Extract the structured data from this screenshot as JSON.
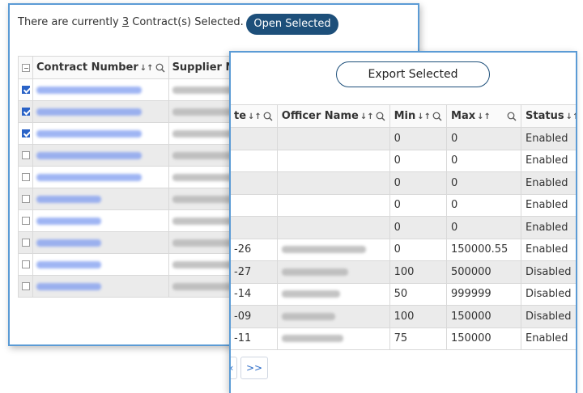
{
  "back_panel": {
    "status_prefix": "There are currently ",
    "selected_count": "3",
    "status_suffix": " Contract(s) Selected.",
    "open_button": "Open Selected",
    "columns": {
      "contract_number": "Contract Number",
      "supplier": "Supplier N"
    },
    "rows": [
      {
        "checked": true
      },
      {
        "checked": true
      },
      {
        "checked": true
      },
      {
        "checked": false
      },
      {
        "checked": false
      },
      {
        "checked": false
      },
      {
        "checked": false
      },
      {
        "checked": false
      },
      {
        "checked": false
      },
      {
        "checked": false
      }
    ]
  },
  "front_panel": {
    "export_button": "Export Selected",
    "columns": {
      "date": "te",
      "officer": "Officer Name",
      "min": "Min",
      "max": "Max",
      "status": "Status"
    },
    "rows": [
      {
        "date": "",
        "min": "0",
        "max": "0",
        "status": "Enabled"
      },
      {
        "date": "",
        "min": "0",
        "max": "0",
        "status": "Enabled"
      },
      {
        "date": "",
        "min": "0",
        "max": "0",
        "status": "Enabled"
      },
      {
        "date": "",
        "min": "0",
        "max": "0",
        "status": "Enabled"
      },
      {
        "date": "",
        "min": "0",
        "max": "0",
        "status": "Enabled"
      },
      {
        "date": "-26",
        "min": "0",
        "max": "150000.55",
        "status": "Enabled"
      },
      {
        "date": "-27",
        "min": "100",
        "max": "500000",
        "status": "Disabled"
      },
      {
        "date": "-14",
        "min": "50",
        "max": "999999",
        "status": "Disabled"
      },
      {
        "date": "-09",
        "min": "100",
        "max": "150000",
        "status": "Disabled"
      },
      {
        "date": "-11",
        "min": "75",
        "max": "150000",
        "status": "Enabled"
      }
    ],
    "pager": {
      "prev_label": "‹",
      "next_label": ">>"
    }
  },
  "icons": {
    "sort": "sort-icon",
    "search": "search-icon",
    "select_all": "checkbox-icon"
  },
  "colors": {
    "primary_button": "#1d4f7a",
    "panel_border": "#5b9bd5",
    "checkbox_checked": "#2a63c7",
    "link_blur": "#7f9cf0"
  }
}
